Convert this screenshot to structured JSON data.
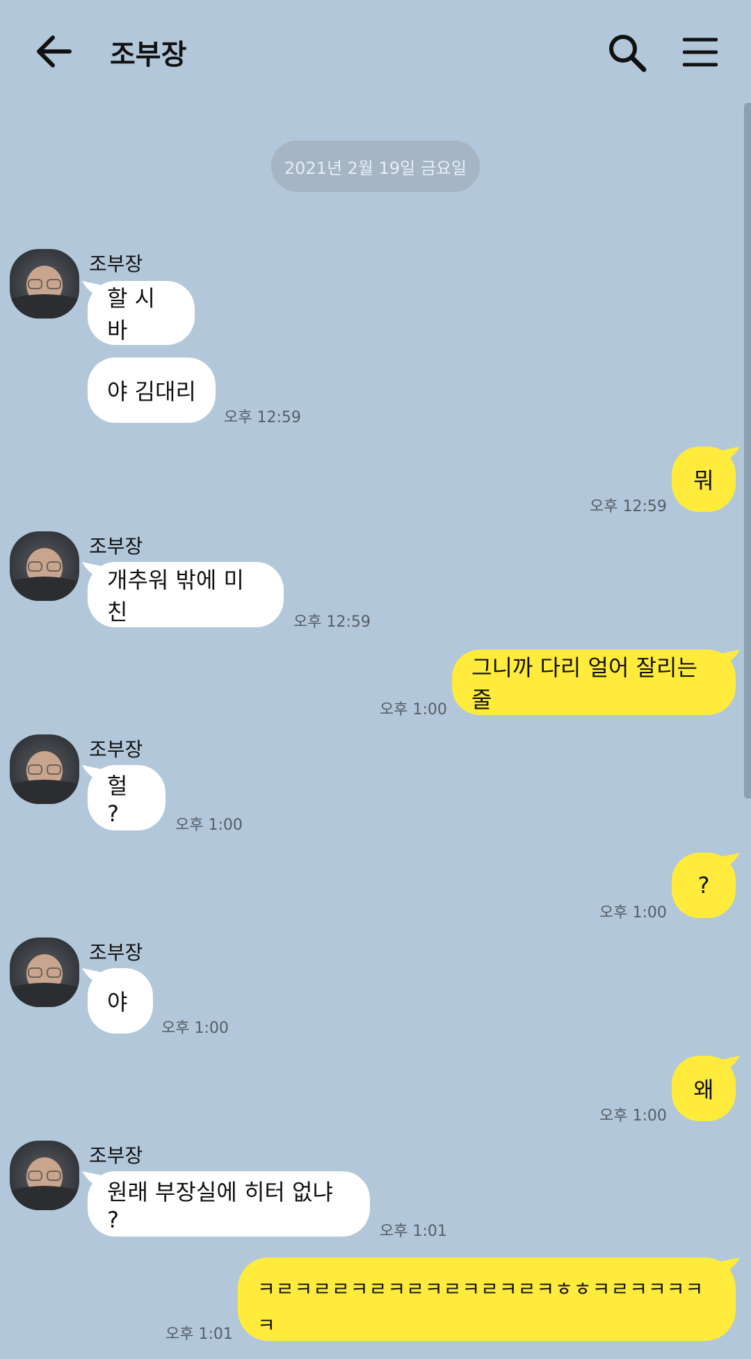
{
  "header": {
    "title": "조부장"
  },
  "date_divider": "2021년 2월 19일 금요일",
  "colors": {
    "background": "#b2c7da",
    "my_bubble": "#feeb3c",
    "their_bubble": "#ffffff",
    "date_pill": "#a5b5c4"
  },
  "icons": {
    "back": "arrow-left-icon",
    "search": "search-icon",
    "menu": "hamburger-menu-icon"
  },
  "messages": [
    {
      "sender": "조부장",
      "text": "할 시바"
    },
    {
      "text": "야 김대리",
      "time": "오후 12:59"
    },
    {
      "text": "뭐",
      "time": "오후 12:59"
    },
    {
      "sender": "조부장",
      "text": "개추워 밖에 미친",
      "time": "오후 12:59"
    },
    {
      "text": "그니까 다리 얼어 잘리는줄",
      "time": "오후 1:00"
    },
    {
      "sender": "조부장",
      "text": "헐 ?",
      "time": "오후 1:00"
    },
    {
      "text": "?",
      "time": "오후 1:00"
    },
    {
      "sender": "조부장",
      "text": "야",
      "time": "오후 1:00"
    },
    {
      "text": "왜",
      "time": "오후 1:00"
    },
    {
      "sender": "조부장",
      "text": "원래 부장실에 히터 없냐 ?",
      "time": "오후 1:01"
    },
    {
      "text": "ㅋㄹㅋㄹㄹㅋㄹㅋㄹㅋㄹㅋㄹㅋㄹㅋㅎㅎㅋㄹㅋㅋㅋㅋㅋ",
      "time": "오후 1:01"
    }
  ]
}
